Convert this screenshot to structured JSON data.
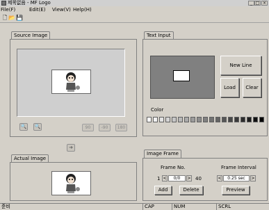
{
  "window": {
    "title": "제목없음 - MF Logo"
  },
  "menu": [
    "File(F)",
    "Edit(E)",
    "View(V)",
    "Help(H)"
  ],
  "toolbar": {
    "new_icon": "🗋",
    "open_icon": "📂",
    "save_icon": "💾"
  },
  "source_panel": {
    "tab": "Source Image",
    "zoom_out_icon": "🔍",
    "zoom_in_icon": "🔍",
    "rotate": [
      "90",
      "-90",
      "180"
    ],
    "copy_arrow": "➜"
  },
  "actual_panel": {
    "tab": "Actual Image"
  },
  "text_panel": {
    "tab": "Text Input",
    "new_line": "New Line",
    "load": "Load",
    "clear": "Clear",
    "color_label": "Color",
    "colors": [
      "#ffffff",
      "#f0f0f0",
      "#e2e2e2",
      "#d4d4d4",
      "#c6c6c6",
      "#b8b8b8",
      "#aaaaaa",
      "#9c9c9c",
      "#8e8e8e",
      "#808080",
      "#727272",
      "#646464",
      "#565656",
      "#484848",
      "#3a3a3a",
      "#2c2c2c",
      "#1e1e1e",
      "#101010",
      "#000000"
    ]
  },
  "frame_panel": {
    "tab": "Image Frame",
    "frame_no_label": "Frame No.",
    "frame_min": "1",
    "frame_value": "0/0",
    "frame_max": "40",
    "frame_interval_label": "Frame Interval",
    "interval_value": "0.25 sec",
    "add": "Add",
    "delete": "Delete",
    "preview": "Preview"
  },
  "statusbar": [
    "준비",
    "CAP",
    "NUM",
    "SCRL"
  ]
}
